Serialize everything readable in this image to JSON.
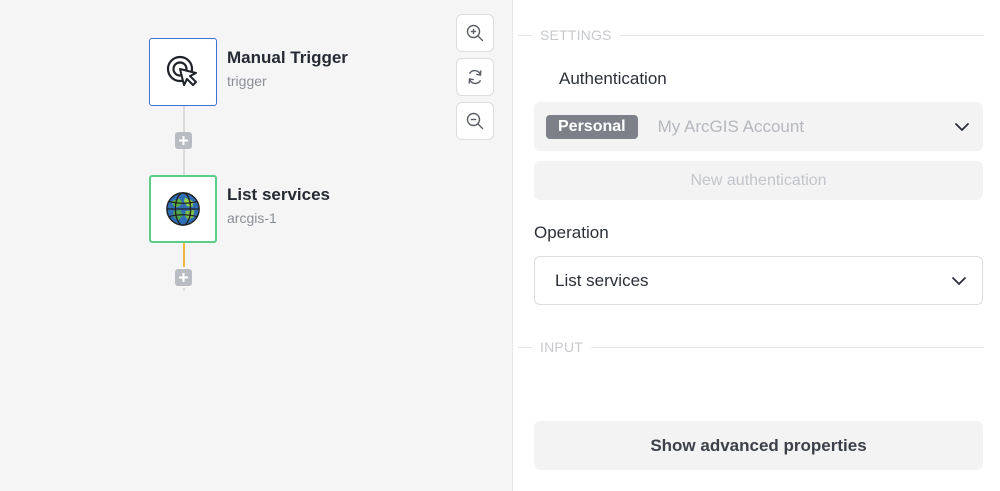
{
  "canvas": {
    "nodes": [
      {
        "title": "Manual Trigger",
        "subtitle": "trigger",
        "icon": "cursor-click-icon"
      },
      {
        "title": "List services",
        "subtitle": "arcgis-1",
        "icon": "arcgis-globe-icon"
      }
    ],
    "zoom_controls": [
      "zoom-in-icon",
      "reset-icon",
      "zoom-out-icon"
    ]
  },
  "panel": {
    "settings_label": "SETTINGS",
    "auth_label": "Authentication",
    "auth_badge": "Personal",
    "auth_value": "My ArcGIS Account",
    "new_auth_label": "New authentication",
    "operation_label": "Operation",
    "operation_value": "List services",
    "input_label": "INPUT",
    "advanced_label": "Show advanced properties"
  },
  "colors": {
    "trigger_border": "#3e6fd8",
    "action_border": "#5bcf8a",
    "connector_active": "#f2b640",
    "badge_bg": "#7d8089"
  }
}
